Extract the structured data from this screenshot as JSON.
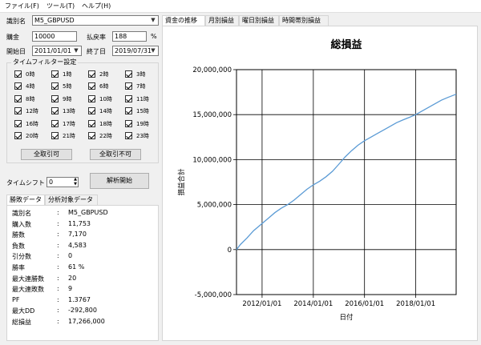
{
  "menu": [
    "ファイル(F)",
    "ツール(T)",
    "ヘルプ(H)"
  ],
  "form": {
    "symbol_label": "識別名",
    "symbol_value": "M5_GBPUSD",
    "capital_label": "購金",
    "capital_value": "10000",
    "payout_label": "払戻率",
    "payout_value": "188",
    "payout_unit": "%",
    "start_label": "開始日",
    "start_value": "2011/01/01",
    "end_label": "終了日",
    "end_value": "2019/07/31"
  },
  "time_filter": {
    "title": "タイムフィルター設定",
    "hours": [
      "0時",
      "1時",
      "2時",
      "3時",
      "4時",
      "5時",
      "6時",
      "7時",
      "8時",
      "9時",
      "10時",
      "11時",
      "12時",
      "13時",
      "14時",
      "15時",
      "16時",
      "17時",
      "18時",
      "19時",
      "20時",
      "21時",
      "22時",
      "23時"
    ],
    "select_all_label": "全取引可",
    "deselect_all_label": "全取引不可"
  },
  "timeshift": {
    "label": "タイムシフト",
    "value": "0"
  },
  "analyze_button": "解析開始",
  "left_tabs": [
    "勝敗データ",
    "分析対象データ"
  ],
  "stats": [
    {
      "label": "識別名",
      "value": "M5_GBPUSD"
    },
    {
      "label": "購入数",
      "value": "11,753"
    },
    {
      "label": "勝数",
      "value": "7,170"
    },
    {
      "label": "負数",
      "value": "4,583"
    },
    {
      "label": "引分数",
      "value": "0"
    },
    {
      "label": "勝率",
      "value": "61 %"
    },
    {
      "label": "最大連勝数",
      "value": "20"
    },
    {
      "label": "最大連敗数",
      "value": "9"
    },
    {
      "label": "PF",
      "value": "1.3767"
    },
    {
      "label": "最大DD",
      "value": "-292,800"
    },
    {
      "label": "総損益",
      "value": "17,266,000"
    }
  ],
  "stat_colon": ":",
  "right_tabs": [
    "資金の推移",
    "月別損益",
    "曜日別損益",
    "時間帯別損益"
  ],
  "colors": {
    "line": "#5b9bd5"
  },
  "chart_data": {
    "type": "line",
    "title": "総損益",
    "xlabel": "日付",
    "ylabel": "損益合計",
    "xlim": [
      "2011/01/01",
      "2019/07/31"
    ],
    "ylim": [
      -5000000,
      20000000
    ],
    "yticks": [
      -5000000,
      0,
      5000000,
      10000000,
      15000000,
      20000000
    ],
    "ytick_labels": [
      "-5,000,000",
      "0",
      "5,000,000",
      "10,000,000",
      "15,000,000",
      "20,000,000"
    ],
    "xticks": [
      "2012/01/01",
      "2014/01/01",
      "2016/01/01",
      "2018/01/01"
    ],
    "grid": true,
    "series": [
      {
        "x": [
          "2011/01/01",
          "2011/03/01",
          "2011/06/01",
          "2011/09/01",
          "2012/01/01",
          "2012/04/01",
          "2012/07/01",
          "2012/10/01",
          "2013/01/01",
          "2013/04/01",
          "2013/07/01",
          "2013/10/01",
          "2014/01/01",
          "2014/04/01",
          "2014/07/01",
          "2014/10/01",
          "2015/01/01",
          "2015/04/01",
          "2015/07/01",
          "2015/10/01",
          "2016/01/01",
          "2016/04/01",
          "2016/07/01",
          "2016/10/01",
          "2017/01/01",
          "2017/04/01",
          "2017/07/01",
          "2017/10/01",
          "2018/01/01",
          "2018/04/01",
          "2018/07/01",
          "2018/10/01",
          "2019/01/01",
          "2019/04/01",
          "2019/07/31"
        ],
        "y": [
          0,
          600000,
          1300000,
          2100000,
          2900000,
          3500000,
          4100000,
          4600000,
          5000000,
          5500000,
          6100000,
          6700000,
          7200000,
          7600000,
          8100000,
          8700000,
          9500000,
          10300000,
          11000000,
          11600000,
          12100000,
          12500000,
          12900000,
          13300000,
          13700000,
          14100000,
          14400000,
          14700000,
          15000000,
          15400000,
          15800000,
          16200000,
          16600000,
          16900000,
          17266000
        ]
      }
    ]
  }
}
